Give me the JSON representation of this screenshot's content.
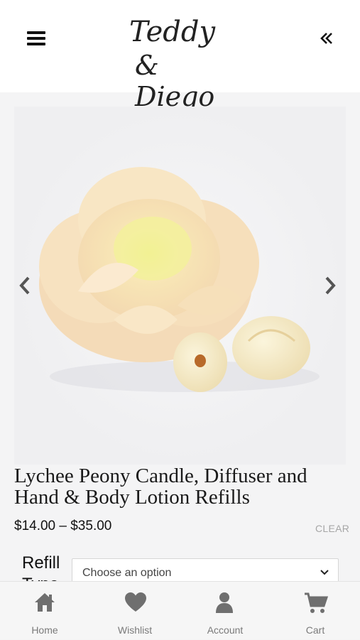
{
  "header": {
    "logo_line1": "Teddy",
    "logo_line2": "& Diego"
  },
  "gallery": {
    "image_alt": "Lychee Peony Candle, Diffuser and Hand & Body Lotion Refills"
  },
  "product": {
    "title_line1": "Lychee Peony Candle, Diffuser and",
    "title_line2": "Hand & Body Lotion Refills",
    "price": "$14.00 – $35.00",
    "clear_label": "CLEAR",
    "variation_label": "Refill Type",
    "select_placeholder": "Choose an option"
  },
  "bottom_nav": {
    "items": [
      {
        "label": "Home",
        "icon": "home-icon"
      },
      {
        "label": "Wishlist",
        "icon": "heart-icon"
      },
      {
        "label": "Account",
        "icon": "user-icon"
      },
      {
        "label": "Cart",
        "icon": "cart-icon"
      }
    ]
  },
  "colors": {
    "icon_gray": "#6f6f6f",
    "background": "#f4f4f5",
    "flower": "#f6e3bd"
  }
}
